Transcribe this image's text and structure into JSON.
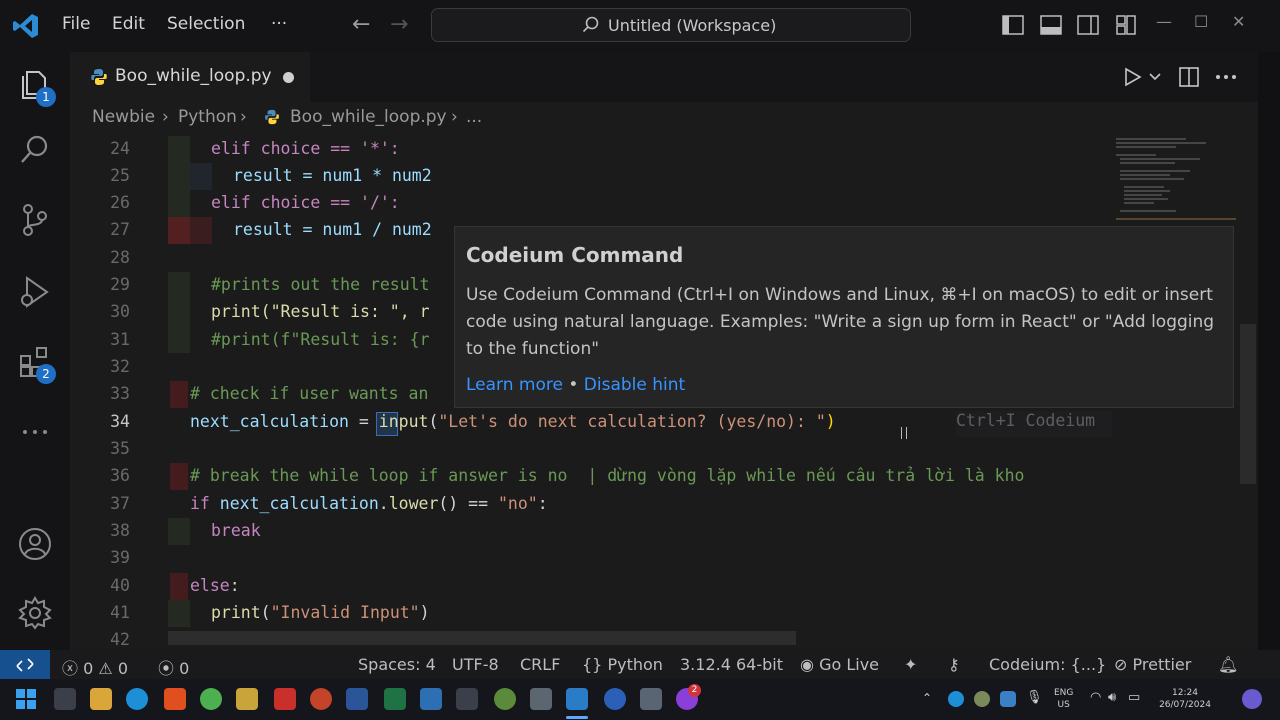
{
  "titlebar": {
    "menu": [
      "File",
      "Edit",
      "Selection",
      "···"
    ],
    "command_center": "Untitled (Workspace)"
  },
  "activity": {
    "explorer_badge": "1",
    "extensions_badge": "2"
  },
  "tab": {
    "label": "Boo_while_loop.py"
  },
  "breadcrumb": {
    "items": [
      "Newbie",
      "Python",
      "Boo_while_loop.py",
      "..."
    ]
  },
  "editor": {
    "line_numbers": [
      "24",
      "25",
      "26",
      "27",
      "28",
      "29",
      "30",
      "31",
      "32",
      "33",
      "34",
      "35",
      "36",
      "37",
      "38",
      "39",
      "40",
      "41",
      "42"
    ],
    "current_line": "34",
    "ghost_text": "Ctrl+I Codeium",
    "lines": {
      "l24": "elif choice == '*':",
      "l25": "result = num1 * num2",
      "l26": "elif choice == '/':",
      "l27": "result = num1 / num2",
      "l29": "#prints out the result",
      "l30": "print(\"Result is: \", r",
      "l31": "#print(f\"Result is: {r",
      "l33": "# check if user wants an",
      "l34a": "next_calculation ",
      "l34b": "=",
      "l34c": " input",
      "l34d": "(",
      "l34e": "\"Let's do next calculation? (yes/no): \"",
      "l34f": ")",
      "l36": "# break the while loop if answer is no  | dừng vòng lặp while nếu câu trả lời là kho",
      "l37a": "if",
      "l37b": " next_calculation",
      "l37c": ".",
      "l37d": "lower",
      "l37e": "() == ",
      "l37f": "\"no\"",
      "l37g": ":",
      "l38": "break",
      "l40a": "else",
      "l40b": ":",
      "l41a": "print",
      "l41b": "(",
      "l41c": "\"Invalid Input\"",
      "l41d": ")"
    }
  },
  "hover": {
    "title": "Codeium Command",
    "body": "Use Codeium Command (Ctrl+I on Windows and Linux, ⌘+I on macOS) to edit or insert code using natural language. Examples: \"Write a sign up form in React\" or \"Add logging to the function\"",
    "learn_more": "Learn more",
    "separator": " • ",
    "disable_hint": "Disable hint"
  },
  "statusbar": {
    "errors": "0",
    "warnings": "0",
    "ports": "0",
    "spaces": "Spaces: 4",
    "encoding": "UTF-8",
    "eol": "CRLF",
    "language": "Python",
    "interpreter": "3.12.4 64-bit",
    "go_live": "Go Live",
    "codeium": "Codeium: {...}",
    "prettier": "Prettier"
  },
  "taskbar": {
    "lang": "ENG",
    "region": "US",
    "time": "12:24",
    "date": "26/07/2024",
    "messenger_badge": "2"
  },
  "colors": {
    "accent": "#3794ff",
    "remote": "#16508f",
    "badge": "#1f6fc4"
  }
}
